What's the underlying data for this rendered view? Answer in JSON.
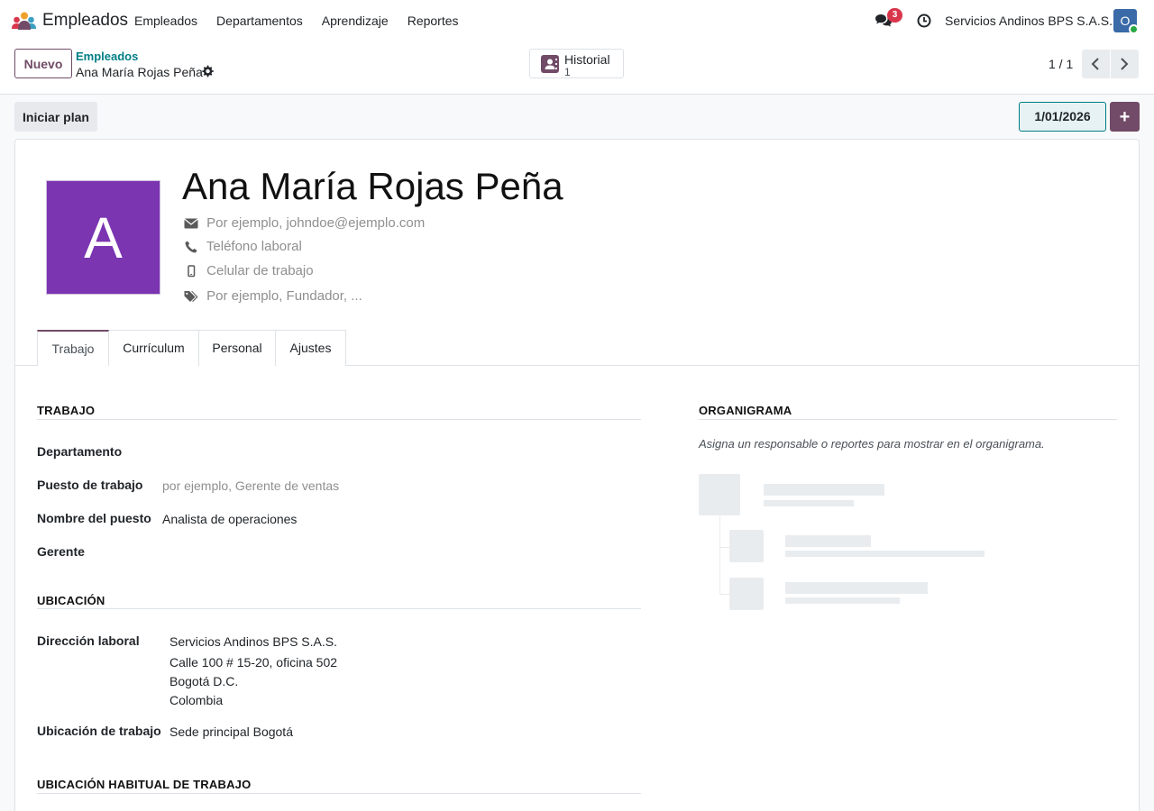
{
  "navbar": {
    "app_name": "Empleados",
    "menu": [
      "Empleados",
      "Departamentos",
      "Aprendizaje",
      "Reportes"
    ],
    "messages_count": "3",
    "company": "Servicios Andinos BPS S.A.S.",
    "user_initial": "O"
  },
  "control": {
    "new_label": "Nuevo",
    "breadcrumb_parent": "Empleados",
    "breadcrumb_current": "Ana María Rojas Peña",
    "history_label": "Historial",
    "history_count": "1",
    "pager": "1 / 1"
  },
  "statusbar": {
    "plan_label": "Iniciar plan",
    "date": "1/01/2026",
    "plus": "+"
  },
  "employee": {
    "initial": "A",
    "name": "Ana María Rojas Peña",
    "email_placeholder": "Por ejemplo, johndoe@ejemplo.com",
    "phone_placeholder": "Teléfono laboral",
    "mobile_placeholder": "Celular de trabajo",
    "tags_placeholder": "Por ejemplo, Fundador, ..."
  },
  "tabs": [
    "Trabajo",
    "Currículum",
    "Personal",
    "Ajustes"
  ],
  "work": {
    "title": "TRABAJO",
    "department_label": "Departamento",
    "job_position_label": "Puesto de trabajo",
    "job_position_placeholder": "por ejemplo, Gerente de ventas",
    "job_title_label": "Nombre del puesto",
    "job_title_value": "Analista de operaciones",
    "manager_label": "Gerente"
  },
  "location": {
    "title": "UBICACIÓN",
    "address_label": "Dirección laboral",
    "address_lines": [
      "Servicios Andinos BPS S.A.S.",
      "Calle 100 # 15-20, oficina 502",
      "Bogotá D.C.",
      "Colombia"
    ],
    "work_location_label": "Ubicación de trabajo",
    "work_location_value": "Sede principal Bogotá"
  },
  "habitual": {
    "title": "UBICACIÓN HABITUAL DE TRABAJO"
  },
  "org": {
    "title": "ORGANIGRAMA",
    "hint": "Asigna un responsable o reportes para mostrar en el organigrama."
  },
  "colors": {
    "brand": "#714b67",
    "teal": "#017e84",
    "avatar": "#7b35b1",
    "badge": "#d9364c"
  }
}
